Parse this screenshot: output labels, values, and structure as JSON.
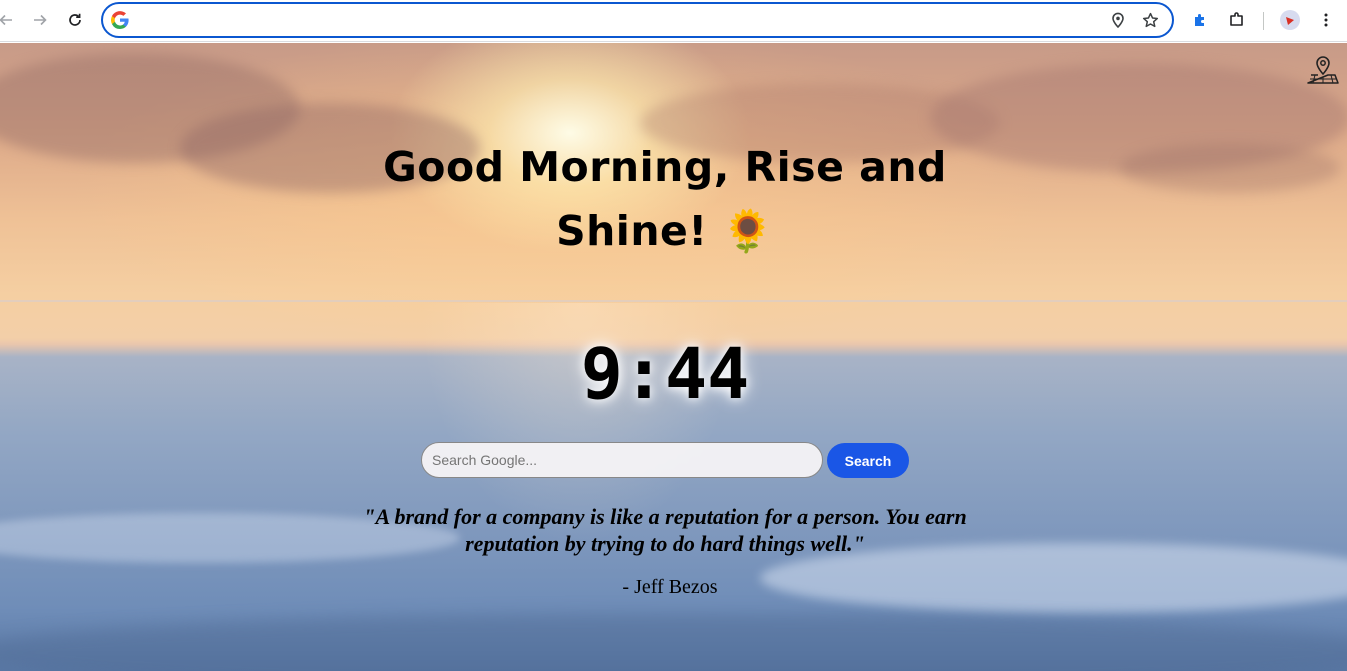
{
  "browser": {
    "address_value": "",
    "icons": {
      "back": "back-arrow-icon",
      "forward": "forward-arrow-icon",
      "reload": "reload-icon",
      "site": "google-icon",
      "location": "location-pin-icon",
      "bookmark": "bookmark-star-icon",
      "extensions": "puzzle-extension-icon",
      "side_panel": "side-panel-icon",
      "profile": "profile-avatar-icon",
      "menu": "kebab-menu-icon"
    },
    "colors": {
      "accent": "#0b57d0"
    }
  },
  "page": {
    "greeting": "Good Morning, Rise and Shine! 🌻",
    "clock": "9:44",
    "search": {
      "placeholder": "Search Google...",
      "value": "",
      "button_label": "Search"
    },
    "quote": "\"A brand for a company is like a reputation for a person. You earn reputation by trying to do hard things well.\"",
    "author": "- Jeff Bezos",
    "map_icon": "map-location-icon",
    "colors": {
      "search_button": "#1a56e6"
    }
  }
}
